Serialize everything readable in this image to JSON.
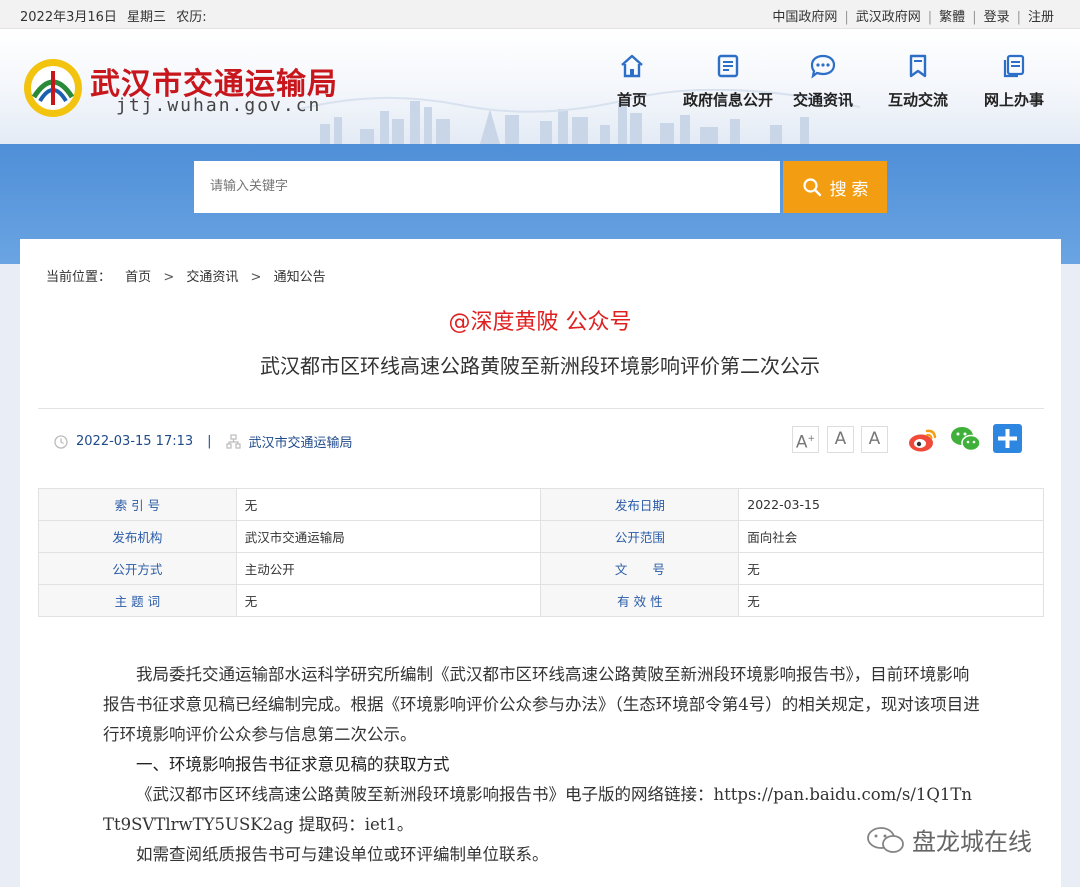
{
  "topbar": {
    "date": "2022年3月16日",
    "weekday": "星期三",
    "lunar": "农历:",
    "links": [
      "中国政府网",
      "武汉政府网",
      "繁體",
      "登录",
      "注册"
    ]
  },
  "header": {
    "title": "武汉市交通运输局",
    "url": "jtj.wuhan.gov.cn",
    "nav": [
      {
        "label": "首页",
        "icon": "home-icon"
      },
      {
        "label": "政府信息公开",
        "icon": "document-icon"
      },
      {
        "label": "交通资讯",
        "icon": "chat-icon"
      },
      {
        "label": "互动交流",
        "icon": "bookmark-icon"
      },
      {
        "label": "网上办事",
        "icon": "copy-icon"
      }
    ]
  },
  "search": {
    "placeholder": "请输入关键字",
    "button": "搜 索"
  },
  "breadcrumb": {
    "prefix": "当前位置：",
    "items": [
      "首页",
      "交通资讯",
      "通知公告"
    ],
    "sep": ">"
  },
  "overlay_text": "@深度黄陂 公众号",
  "article": {
    "title": "武汉都市区环线高速公路黄陂至新洲段环境影响评价第二次公示",
    "datetime": "2022-03-15 17:13",
    "divider": "|",
    "publisher": "武汉市交通运输局",
    "font_sizes": [
      "A+",
      "A",
      "A-"
    ]
  },
  "share": {
    "icons": [
      "weibo-icon",
      "wechat-icon",
      "plus-share-icon"
    ]
  },
  "info": {
    "rows": [
      {
        "k1": "索 引 号",
        "v1": "无",
        "k2": "发布日期",
        "v2": "2022-03-15"
      },
      {
        "k1": "发布机构",
        "v1": "武汉市交通运输局",
        "k2": "公开范围",
        "v2": "面向社会"
      },
      {
        "k1": "公开方式",
        "v1": "主动公开",
        "k2": "文　　号",
        "v2": "无"
      },
      {
        "k1": "主 题 词",
        "v1": "无",
        "k2": "有 效 性",
        "v2": "无"
      }
    ]
  },
  "body": {
    "p1": "我局委托交通运输部水运科学研究所编制《武汉都市区环线高速公路黄陂至新洲段环境影响报告书》，目前环境影响报告书征求意见稿已经编制完成。根据《环境影响评价公众参与办法》（生态环境部令第4号）的相关规定，现对该项目进行环境影响评价公众参与信息第二次公示。",
    "h1": "一、环境影响报告书征求意见稿的获取方式",
    "p2": "《武汉都市区环线高速公路黄陂至新洲段环境影响报告书》电子版的网络链接：https://pan.baidu.com/s/1Q1TnTt9SVTlrwTY5USK2ag 提取码：iet1。",
    "p3": "如需查阅纸质报告书可与建设单位或环评编制单位联系。"
  },
  "watermark": "盘龙城在线",
  "colors": {
    "brand_red": "#c8161d",
    "band_blue": "#5b97dc",
    "search_orange": "#f39d12",
    "link_blue": "#1f4a8a"
  }
}
